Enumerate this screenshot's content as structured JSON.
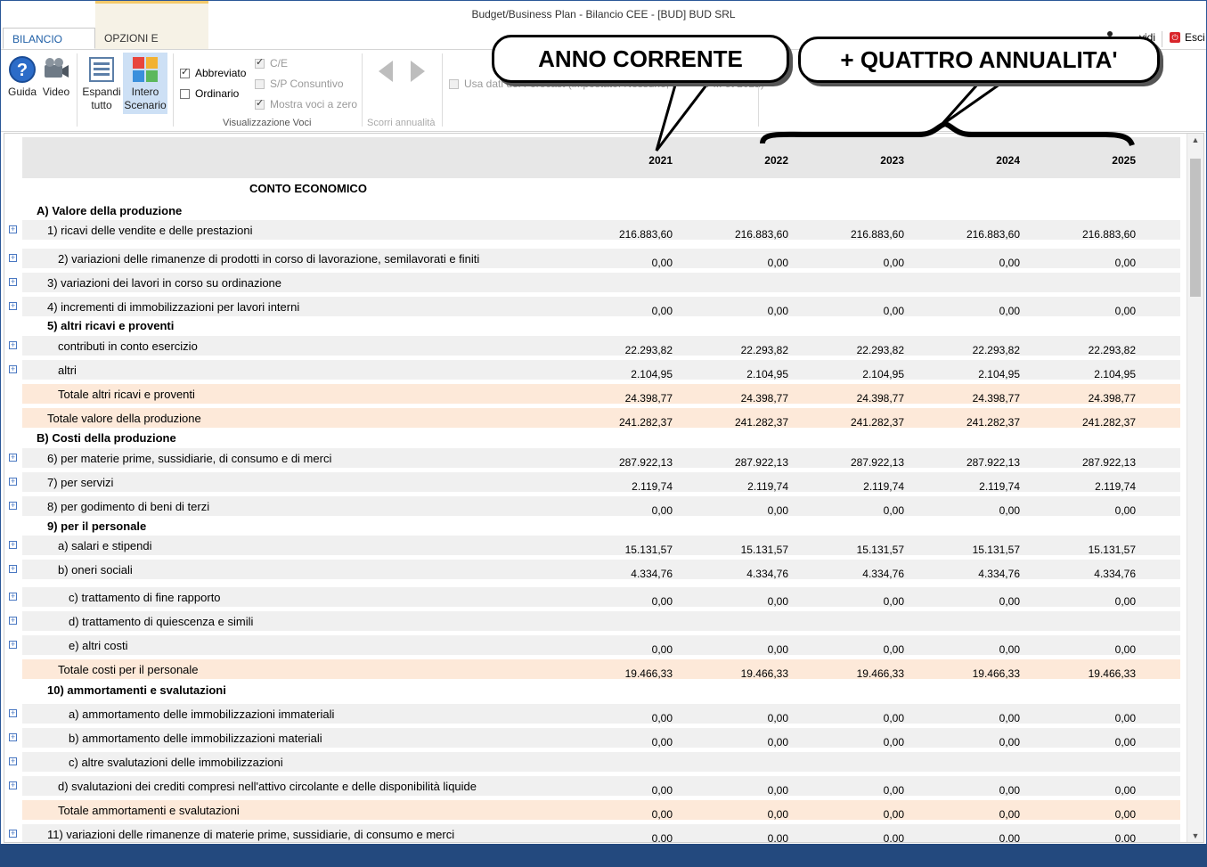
{
  "window": {
    "title": "Budget/Business Plan - Bilancio CEE - [BUD] BUD SRL"
  },
  "tabs": [
    {
      "label": "BILANCIO CEE"
    },
    {
      "label": "OPZIONI E STAMPA"
    }
  ],
  "top_right": {
    "condividi_label": "vidi",
    "esci_label": "Esci"
  },
  "ribbon": {
    "guida_label": "Guida",
    "video_label": "Video",
    "espandi_line1": "Espandi",
    "espandi_line2": "tutto",
    "intero_line1": "Intero",
    "intero_line2": "Scenario",
    "abbreviato": "Abbreviato",
    "ordinario": "Ordinario",
    "ce": "C/E",
    "sp_consuntivo": "S/P Consuntivo",
    "mostra_voci": "Mostra voci a zero",
    "visualizzazione_voci": "Visualizzazione Voci",
    "scorri_annualita": "Scorri annualità",
    "forecast_text": "Usa dati del Forecast (impostato: Nessuno; solo per ... et 2021)"
  },
  "callouts": {
    "anno_corrente": "ANNO CORRENTE",
    "quattro_annualita": "+ QUATTRO ANNUALITA'"
  },
  "columns": [
    "2021",
    "2022",
    "2023",
    "2024",
    "2025"
  ],
  "rows": [
    {
      "label": "CONTO ECONOMICO",
      "type": "title"
    },
    {
      "label": "A) Valore della produzione",
      "type": "header"
    },
    {
      "label": "1) ricavi delle vendite e delle prestazioni",
      "values": [
        "216.883,60",
        "216.883,60",
        "216.883,60",
        "216.883,60",
        "216.883,60"
      ],
      "expand": true
    },
    {
      "label": "2) variazioni delle rimanenze di prodotti in corso di lavorazione, semilavorati e finiti",
      "values": [
        "0,00",
        "0,00",
        "0,00",
        "0,00",
        "0,00"
      ],
      "expand": true
    },
    {
      "label": "3) variazioni dei lavori in corso su ordinazione",
      "values": [],
      "expand": true
    },
    {
      "label": "4) incrementi di immobilizzazioni per lavori interni",
      "values": [
        "0,00",
        "0,00",
        "0,00",
        "0,00",
        "0,00"
      ],
      "expand": true
    },
    {
      "label": "5) altri ricavi e proventi",
      "type": "header"
    },
    {
      "label": "contributi in conto esercizio",
      "values": [
        "22.293,82",
        "22.293,82",
        "22.293,82",
        "22.293,82",
        "22.293,82"
      ],
      "expand": true
    },
    {
      "label": "altri",
      "values": [
        "2.104,95",
        "2.104,95",
        "2.104,95",
        "2.104,95",
        "2.104,95"
      ],
      "expand": true
    },
    {
      "label": "Totale altri ricavi e proventi",
      "values": [
        "24.398,77",
        "24.398,77",
        "24.398,77",
        "24.398,77",
        "24.398,77"
      ],
      "type": "total"
    },
    {
      "label": "Totale valore della produzione",
      "values": [
        "241.282,37",
        "241.282,37",
        "241.282,37",
        "241.282,37",
        "241.282,37"
      ],
      "type": "total"
    },
    {
      "label": "B) Costi della produzione",
      "type": "header"
    },
    {
      "label": "6) per materie prime, sussidiarie, di consumo e di merci",
      "values": [
        "287.922,13",
        "287.922,13",
        "287.922,13",
        "287.922,13",
        "287.922,13"
      ],
      "expand": true
    },
    {
      "label": "7) per servizi",
      "values": [
        "2.119,74",
        "2.119,74",
        "2.119,74",
        "2.119,74",
        "2.119,74"
      ],
      "expand": true
    },
    {
      "label": "8) per godimento di beni di terzi",
      "values": [
        "0,00",
        "0,00",
        "0,00",
        "0,00",
        "0,00"
      ],
      "expand": true
    },
    {
      "label": "9) per il personale",
      "type": "header"
    },
    {
      "label": "a) salari e stipendi",
      "values": [
        "15.131,57",
        "15.131,57",
        "15.131,57",
        "15.131,57",
        "15.131,57"
      ],
      "expand": true
    },
    {
      "label": "b) oneri sociali",
      "values": [
        "4.334,76",
        "4.334,76",
        "4.334,76",
        "4.334,76",
        "4.334,76"
      ],
      "expand": true
    },
    {
      "label": "c) trattamento di fine rapporto",
      "values": [
        "0,00",
        "0,00",
        "0,00",
        "0,00",
        "0,00"
      ],
      "expand": true
    },
    {
      "label": "d) trattamento di quiescenza e simili",
      "values": [],
      "expand": true
    },
    {
      "label": "e) altri costi",
      "values": [
        "0,00",
        "0,00",
        "0,00",
        "0,00",
        "0,00"
      ],
      "expand": true
    },
    {
      "label": "Totale costi per il personale",
      "values": [
        "19.466,33",
        "19.466,33",
        "19.466,33",
        "19.466,33",
        "19.466,33"
      ],
      "type": "total"
    },
    {
      "label": "10) ammortamenti e svalutazioni",
      "type": "header"
    },
    {
      "label": "a) ammortamento delle immobilizzazioni immateriali",
      "values": [
        "0,00",
        "0,00",
        "0,00",
        "0,00",
        "0,00"
      ],
      "expand": true
    },
    {
      "label": "b) ammortamento delle immobilizzazioni materiali",
      "values": [
        "0,00",
        "0,00",
        "0,00",
        "0,00",
        "0,00"
      ],
      "expand": true
    },
    {
      "label": "c) altre svalutazioni delle immobilizzazioni",
      "values": [],
      "expand": true
    },
    {
      "label": "d) svalutazioni dei crediti compresi nell'attivo circolante e delle disponibilità liquide",
      "values": [
        "0,00",
        "0,00",
        "0,00",
        "0,00",
        "0,00"
      ],
      "expand": true
    },
    {
      "label": "Totale ammortamenti e svalutazioni",
      "values": [
        "0,00",
        "0,00",
        "0,00",
        "0,00",
        "0,00"
      ],
      "type": "total"
    },
    {
      "label": "11) variazioni delle rimanenze di materie prime, sussidiarie, di consumo e merci",
      "values": [
        "0,00",
        "0,00",
        "0,00",
        "0,00",
        "0,00"
      ],
      "expand": true
    }
  ]
}
